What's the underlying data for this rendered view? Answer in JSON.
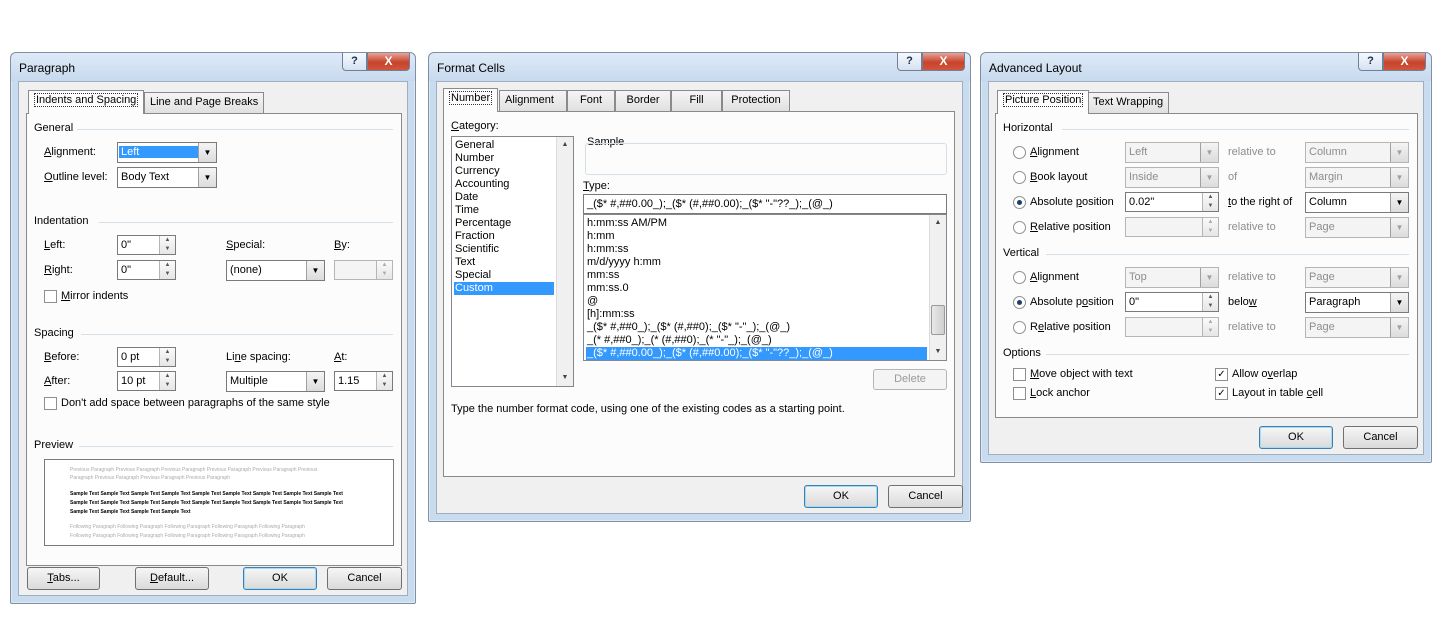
{
  "paragraph": {
    "title": "Paragraph",
    "help": "?",
    "close": "X",
    "tabs": [
      "Indents and Spacing",
      "Line and Page Breaks"
    ],
    "general_heading": "General",
    "alignment_label": "Alignment:",
    "alignment_value": "Left",
    "outline_label": "Outline level:",
    "outline_value": "Body Text",
    "indentation_heading": "Indentation",
    "left_label": "Left:",
    "left_value": "0\"",
    "right_label": "Right:",
    "right_value": "0\"",
    "special_label": "Special:",
    "special_value": "(none)",
    "by_label": "By:",
    "by_value": "",
    "mirror_label": "Mirror indents",
    "spacing_heading": "Spacing",
    "before_label": "Before:",
    "before_value": "0 pt",
    "after_label": "After:",
    "after_value": "10 pt",
    "line_spacing_label": "Line spacing:",
    "line_spacing_value": "Multiple",
    "at_label": "At:",
    "at_value": "1.15",
    "dont_add_label": "Don't add space between paragraphs of the same style",
    "preview_heading": "Preview",
    "preview_prev": [
      "Previous Paragraph Previous Paragraph Previous Paragraph Previous Paragraph Previous Paragraph Previous",
      "Paragraph Previous Paragraph Previous Paragraph Previous Paragraph"
    ],
    "preview_sample": [
      "Sample Text Sample Text Sample Text Sample Text Sample Text Sample Text Sample Text Sample Text Sample Text",
      "Sample Text Sample Text Sample Text Sample Text Sample Text Sample Text Sample Text Sample Text Sample Text",
      "Sample Text Sample Text Sample Text Sample Text"
    ],
    "preview_follow": [
      "Following Paragraph Following Paragraph Following Paragraph Following Paragraph Following Paragraph",
      "Following Paragraph Following Paragraph Following Paragraph Following Paragraph Following Paragraph"
    ],
    "tabs_button": "Tabs...",
    "default_button": "Default...",
    "ok_button": "OK",
    "cancel_button": "Cancel"
  },
  "format_cells": {
    "title": "Format Cells",
    "help": "?",
    "close": "X",
    "tabs": [
      "Number",
      "Alignment",
      "Font",
      "Border",
      "Fill",
      "Protection"
    ],
    "category_label": "Category:",
    "categories": [
      "General",
      "Number",
      "Currency",
      "Accounting",
      "Date",
      "Time",
      "Percentage",
      "Fraction",
      "Scientific",
      "Text",
      "Special",
      "Custom"
    ],
    "selected_category": "Custom",
    "sample_label": "Sample",
    "type_label": "Type:",
    "type_value": "_($* #,##0.00_);_($* (#,##0.00);_($* \"-\"??_);_(@_)",
    "formats": [
      "h:mm:ss AM/PM",
      "h:mm",
      "h:mm:ss",
      "m/d/yyyy h:mm",
      "mm:ss",
      "mm:ss.0",
      "@",
      "[h]:mm:ss",
      "_($* #,##0_);_($* (#,##0);_($* \"-\"_);_(@_)",
      "_(* #,##0_);_(* (#,##0);_(* \"-\"_);_(@_)",
      "_($* #,##0.00_);_($* (#,##0.00);_($* \"-\"??_);_(@_)"
    ],
    "delete_button": "Delete",
    "hint": "Type the number format code, using one of the existing codes as a starting point.",
    "ok_button": "OK",
    "cancel_button": "Cancel"
  },
  "advanced_layout": {
    "title": "Advanced Layout",
    "help": "?",
    "close": "X",
    "tabs": [
      "Picture Position",
      "Text Wrapping"
    ],
    "horizontal_heading": "Horizontal",
    "h_alignment_label": "Alignment",
    "h_alignment_value": "Left",
    "h_alignment_rel_label": "relative to",
    "h_alignment_rel_value": "Column",
    "book_layout_label": "Book layout",
    "book_layout_value": "Inside",
    "book_layout_of_label": "of",
    "book_layout_of_value": "Margin",
    "abs_pos_label": "Absolute position",
    "abs_pos_value": "0.02\"",
    "right_of_label": "to the right of",
    "right_of_value": "Column",
    "rel_pos_label": "Relative position",
    "rel_pos_value": "",
    "rel_pos_rel_label": "relative to",
    "rel_pos_rel_value": "Page",
    "vertical_heading": "Vertical",
    "v_alignment_label": "Alignment",
    "v_alignment_value": "Top",
    "v_alignment_rel_label": "relative to",
    "v_alignment_rel_value": "Page",
    "v_abs_pos_label": "Absolute position",
    "v_abs_pos_value": "0\"",
    "below_label": "below",
    "below_value": "Paragraph",
    "v_rel_pos_label": "Relative position",
    "v_rel_pos_value": "",
    "v_rel_pos_rel_label": "relative to",
    "v_rel_pos_rel_value": "Page",
    "options_heading": "Options",
    "move_object_label": "Move object with text",
    "lock_anchor_label": "Lock anchor",
    "allow_overlap_label": "Allow overlap",
    "layout_in_cell_label": "Layout in table cell",
    "ok_button": "OK",
    "cancel_button": "Cancel"
  },
  "colors": {
    "selection": "#3399ff",
    "frame": "#c9dcef",
    "close_button": "#c7432c"
  }
}
